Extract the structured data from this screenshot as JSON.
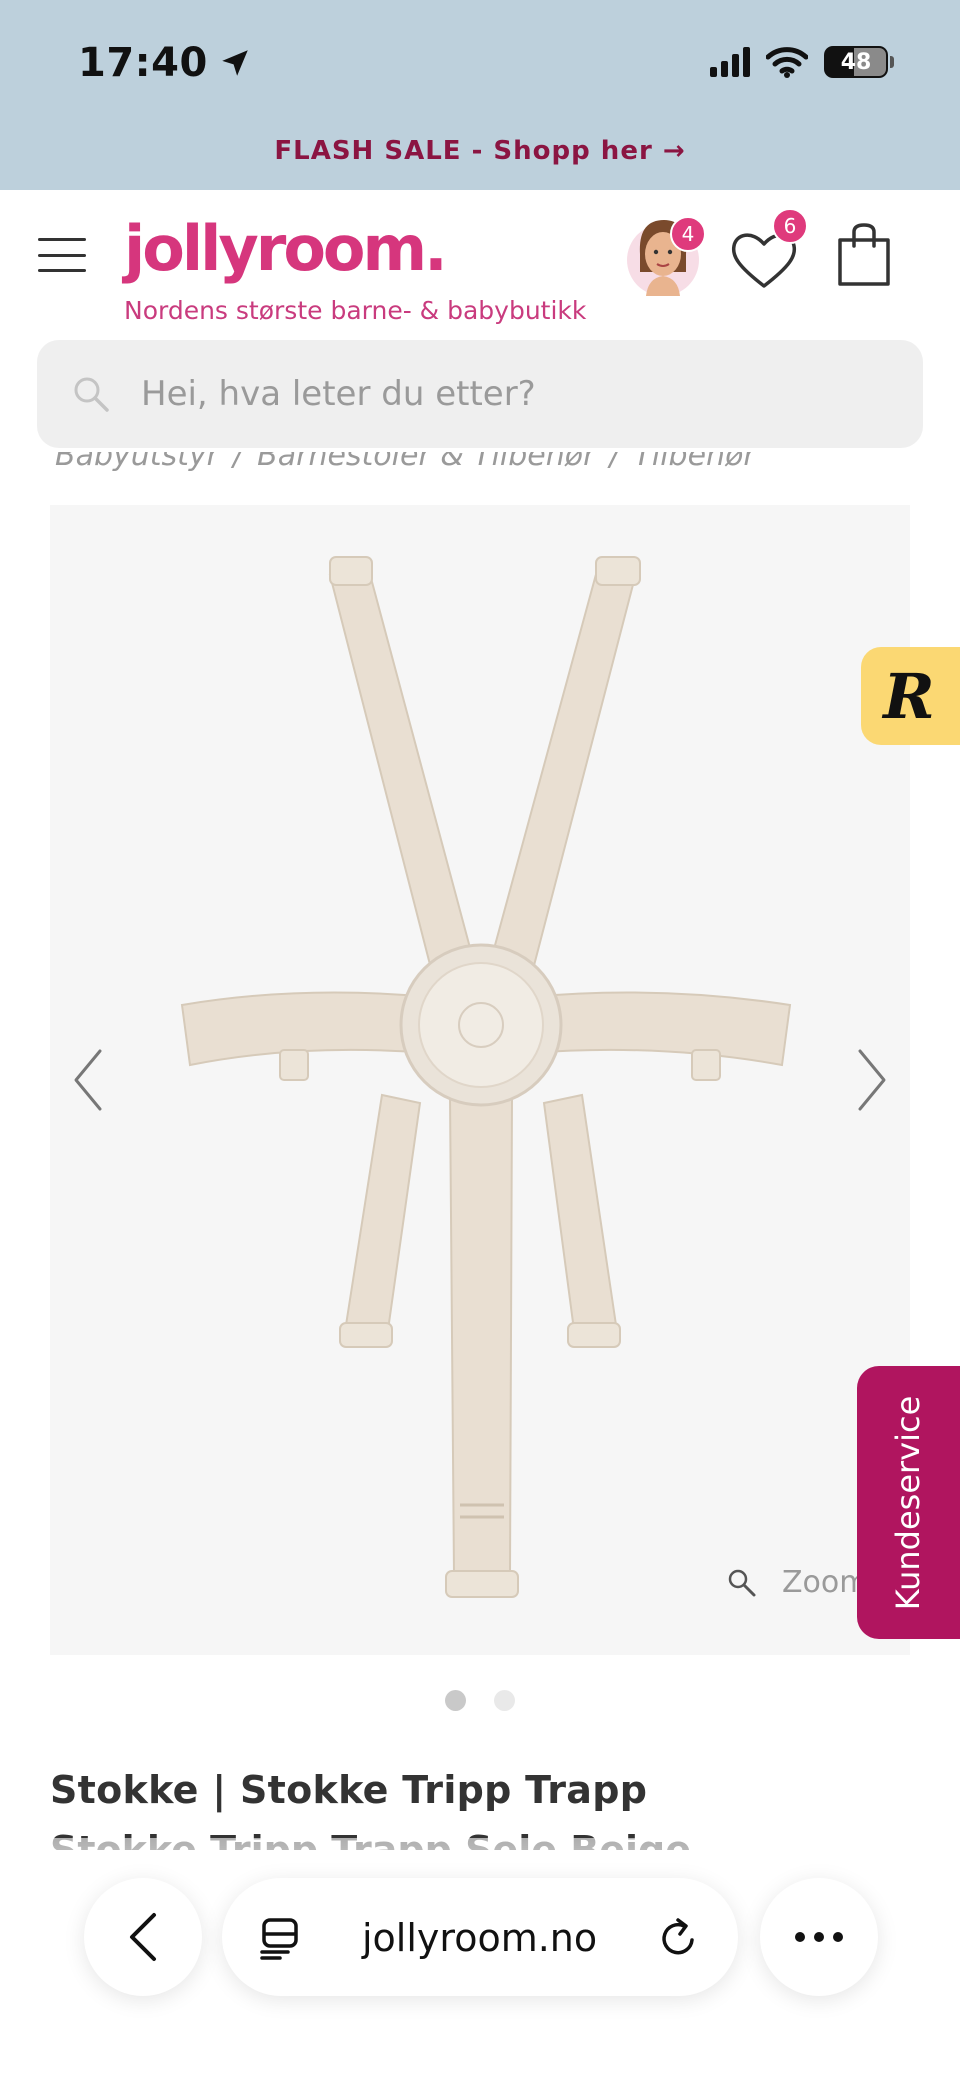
{
  "status_bar": {
    "time": "17:40",
    "battery": "48"
  },
  "flash_banner": {
    "text": "FLASH SALE - Shopp her →"
  },
  "header": {
    "logo": "jollyroom.",
    "tagline": "Nordens største barne- & babybutikk",
    "avatar_badge": "4",
    "wishlist_badge": "6",
    "brand_color": "#d6367d"
  },
  "search": {
    "placeholder": "Hei, hva leter du etter?"
  },
  "breadcrumb": {
    "items": [
      "Babyutstyr",
      "Barnestoler & Tilbehør",
      "Tilbehør"
    ]
  },
  "gallery": {
    "zoom_label": "Zoom",
    "current_image": 1,
    "image_count": 2
  },
  "product": {
    "title_line1": "Stokke | Stokke Tripp Trapp",
    "title_line2": "Stokke Tripp Trapp Sele Beige"
  },
  "widgets": {
    "review_logo": "R",
    "customer_service": "Kundeservice",
    "customer_service_color": "#b0155f"
  },
  "browser": {
    "url": "jollyroom.no"
  }
}
